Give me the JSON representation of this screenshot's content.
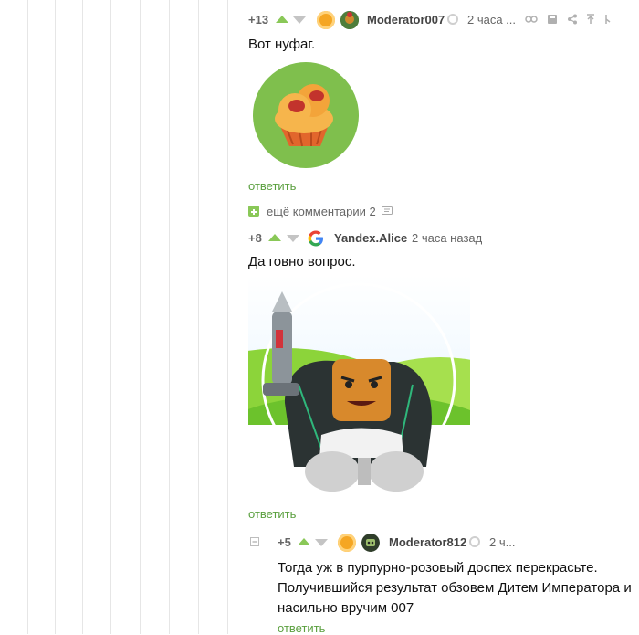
{
  "comments": [
    {
      "rating": "+13",
      "user": "Moderator007",
      "time": "2 часа ...",
      "text": "Вот нуфаг.",
      "reply": "ответить"
    },
    {
      "more_label": "ещё комментарии 2",
      "rating": "+8",
      "user": "Yandex.Alice",
      "time": "2 часа назад",
      "text": "Да говно вопрос.",
      "reply": "ответить"
    },
    {
      "rating": "+5",
      "user": "Moderator812",
      "time": "2 ч...",
      "text_lines": [
        "Тогда уж в пурпурно-розовый доспех перекрасьте.",
        "Получившийся результат обзовем Дитем Императора и",
        "насильно вручим 007"
      ],
      "reply": "ответить"
    }
  ],
  "colors": {
    "accent_green": "#8ac858",
    "reply_green": "#5a9f3e",
    "vote_down": "#c4c4c4"
  },
  "icons": [
    "collapse-icon",
    "link-icon",
    "save-icon",
    "share-icon",
    "pin-icon",
    "more-comments-icon",
    "google-icon"
  ]
}
